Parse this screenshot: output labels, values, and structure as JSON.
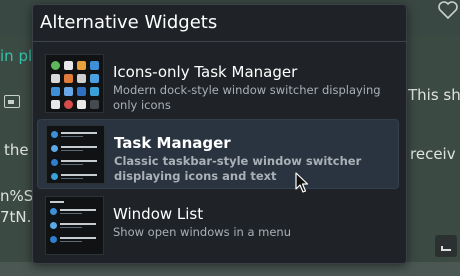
{
  "background": {
    "text_in": "in pl",
    "text_this": "This sh",
    "text_the": "the",
    "text_receive": "receiv",
    "text_code1": "n%S",
    "text_code2": "7tN."
  },
  "popup": {
    "title": "Alternative Widgets",
    "items": [
      {
        "title": "Icons-only Task Manager",
        "description": "Modern dock-style window switcher displaying only icons",
        "selected": false
      },
      {
        "title": "Task Manager",
        "description": "Classic taskbar-style window switcher displaying icons and text",
        "selected": true
      },
      {
        "title": "Window List",
        "description": "Show open windows in a menu",
        "selected": false
      }
    ]
  },
  "colors": {
    "popup_bg": "#1f2327",
    "selected_bg": "#2a3440",
    "accent_link": "#35c4a8"
  },
  "icons": [
    "heart-icon",
    "image-icon",
    "expand-icon",
    "mouse-cursor-icon"
  ]
}
